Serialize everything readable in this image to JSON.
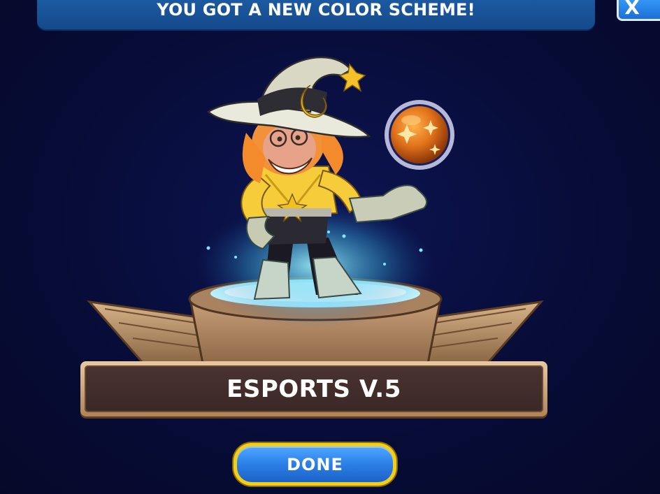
{
  "banner": {
    "title": "YOU GOT A NEW COLOR SCHEME!"
  },
  "close_button": {
    "label": "X"
  },
  "reward": {
    "scheme_name": "ESPORTS V.5"
  },
  "done_button": {
    "label": "DONE"
  },
  "colors": {
    "background": "#060b33",
    "banner": "#1d5ea6",
    "button_blue": "#2b7fe6",
    "button_border": "#f2cf1e",
    "plate_frame": "#c9a274",
    "plate_inner": "#3f2b29"
  },
  "icons": {
    "close": "close-icon",
    "orb": "fire-orb-icon",
    "character": "character-witch-illustration"
  }
}
